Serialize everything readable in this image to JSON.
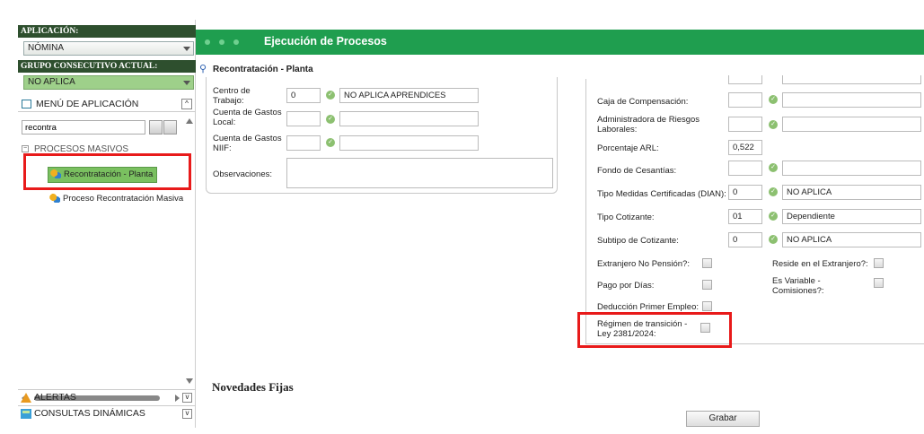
{
  "sidebar": {
    "app_label": "APLICACIÓN:",
    "app_value": "NÓMINA",
    "group_label": "GRUPO CONSECUTIVO ACTUAL:",
    "group_value": "NO APLICA",
    "menu_title": "MENÚ DE APLICACIÓN",
    "search_value": "recontra",
    "tree_group": "PROCESOS MASIVOS",
    "tree_items": [
      "Recontratación - Planta",
      "Proceso Recontratación Masiva"
    ],
    "bottom_items": [
      "ALERTAS",
      "CONSULTAS DINÁMICAS"
    ]
  },
  "header": {
    "title": "Ejecución de Procesos",
    "subtitle": "Recontratación - Planta"
  },
  "form_left": {
    "centro_label": "Centro de Trabajo:",
    "centro_code": "0",
    "centro_desc": "NO APLICA  APRENDICES",
    "gastos_local_label": "Cuenta de Gastos Local:",
    "gastos_niif_label": "Cuenta de Gastos NIIF:",
    "observaciones_label": "Observaciones:"
  },
  "form_right": {
    "caja_label": "Caja de Compensación:",
    "arl_label": "Administradora de Riesgos Laborales:",
    "porcentaje_label": "Porcentaje ARL:",
    "porcentaje_value": "0,522",
    "cesantias_label": "Fondo de Cesantías:",
    "medidas_label": "Tipo Medidas Certificadas (DIAN):",
    "medidas_code": "0",
    "medidas_desc": "NO APLICA",
    "cotizante_label": "Tipo Cotizante:",
    "cotizante_code": "01",
    "cotizante_desc": "Dependiente",
    "subtipo_label": "Subtipo de Cotizante:",
    "subtipo_code": "0",
    "subtipo_desc": "NO APLICA",
    "extranjero_label": "Extranjero No Pensión?:",
    "reside_label": "Reside en el Extranjero?:",
    "pago_label": "Pago por Días:",
    "variable_label": "Es Variable - Comisiones?:",
    "deduccion_label": "Deducción Primer Empleo:",
    "regimen_label": "Régimen de transición - Ley 2381/2024:"
  },
  "novedades_title": "Novedades Fijas",
  "grabar_label": "Grabar",
  "colors": {
    "header_green": "#1f9e4f",
    "highlight_red": "#e81a1a",
    "selected_green": "#7ac060"
  }
}
